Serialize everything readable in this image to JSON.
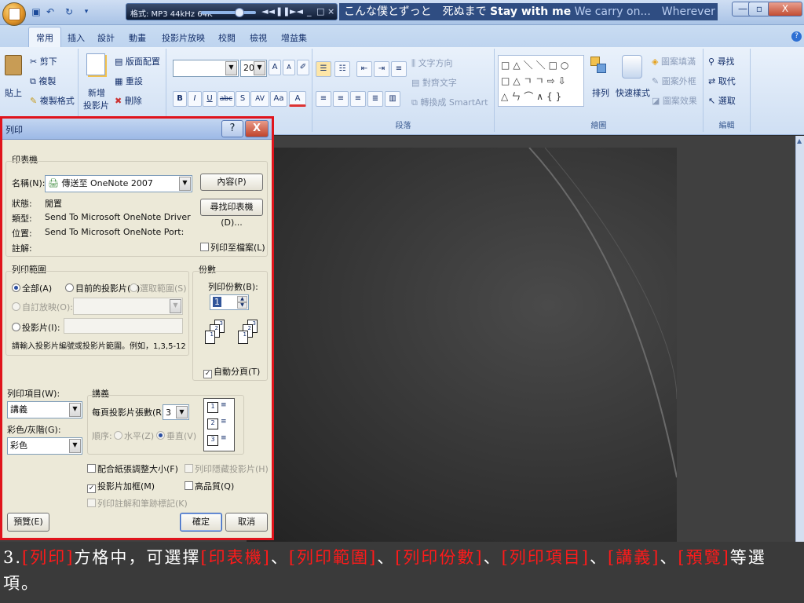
{
  "title_bar": {
    "player_format": "格式: MP3 44kHz 64K",
    "player_controls": [
      "◄◄",
      "❚❚",
      "►◄",
      "_",
      "□",
      "×"
    ],
    "song_text_jp": "こんな僕とずっと　死ぬまで",
    "song_text_en": "Stay with me",
    "song_text_tail": "We carry on...　Wherever",
    "window_controls": [
      "—",
      "▫",
      "X"
    ]
  },
  "tabs": [
    "常用",
    "插入",
    "設計",
    "動畫",
    "投影片放映",
    "校閱",
    "檢視",
    "增益集"
  ],
  "ribbon": {
    "clipboard": {
      "paste": "貼上",
      "cut": "剪下",
      "copy": "複製",
      "format_painter": "複製格式"
    },
    "slides": {
      "new_slide_1": "新增",
      "new_slide_2": "投影片",
      "layout": "版面配置",
      "reset": "重設",
      "delete": "刪除"
    },
    "font": {
      "font_name": "",
      "font_size": "20",
      "bold": "B",
      "italic": "I",
      "underline": "U",
      "strike": "abc",
      "shadow": "S",
      "spacing": "AV",
      "case": "Aa",
      "color": "A",
      "grow": "A",
      "shrink": "A"
    },
    "paragraph": {
      "text_direction": "文字方向",
      "align_text": "對齊文字",
      "smartart": "轉換成 SmartArt",
      "label": "段落"
    },
    "drawing": {
      "shapes": "□△＼＼□○\n□△ㄱㄱ⇨⇩\n△ㄣ⌒∧{}",
      "arrange": "排列",
      "quick_styles": "快速樣式",
      "fill": "圖案填滿",
      "outline": "圖案外框",
      "effects": "圖案效果",
      "label": "繪圖"
    },
    "editing": {
      "find": "尋找",
      "replace": "取代",
      "select": "選取",
      "label": "編輯"
    }
  },
  "dialog": {
    "title": "列印",
    "help": "?",
    "close": "X",
    "printer_group": "印表機",
    "name_label": "名稱(N):",
    "name_value": "傳送至 OneNote 2007",
    "properties_btn": "內容(P)",
    "find_printer_btn": "尋找印表機(D)...",
    "status_label": "狀態:",
    "status_value": "閒置",
    "type_label": "類型:",
    "type_value": "Send To Microsoft OneNote Driver",
    "location_label": "位置:",
    "location_value": "Send To Microsoft OneNote Port:",
    "comment_label": "註解:",
    "print_to_file": "列印至檔案(L)",
    "range_group": "列印範圍",
    "range_all": "全部(A)",
    "range_current": "目前的投影片(C)",
    "range_selection": "選取範圍(S)",
    "range_custom": "自訂放映(O):",
    "range_slides": "投影片(I):",
    "range_hint": "請輸入投影片編號或投影片範圍。例如，1,3,5-12",
    "copies_group": "份數",
    "copies_label": "列印份數(B):",
    "copies_value": "1",
    "collate": "自動分頁(T)",
    "print_what_label": "列印項目(W):",
    "print_what_value": "講義",
    "color_label": "彩色/灰階(G):",
    "color_value": "彩色",
    "handouts_group": "講義",
    "per_page_label": "每頁投影片張數(R):",
    "per_page_value": "3",
    "order_label": "順序:",
    "order_horizontal": "水平(Z)",
    "order_vertical": "垂直(V)",
    "scale_to_fit": "配合紙張調整大小(F)",
    "frame_slides": "投影片加框(M)",
    "print_comments": "列印註解和筆跡標記(K)",
    "print_hidden": "列印隱藏投影片(H)",
    "high_quality": "高品質(Q)",
    "preview_btn": "預覽(E)",
    "ok_btn": "確定",
    "cancel_btn": "取消"
  },
  "caption": {
    "prefix": "3.",
    "t1": "[列印]",
    "t2": "方格中，可選擇",
    "t3": "[印表機]",
    "t4": "、",
    "t5": "[列印範圍]",
    "t6": "、",
    "t7": "[列印份數]",
    "t8": "、",
    "t9": "[列印項目]",
    "t10": "、",
    "t11": "[講義]",
    "t12": "、",
    "t13": "[預覽]",
    "t14": "等選項。"
  },
  "colors": {
    "highlight": "#ff1a1a",
    "dialog_border": "#e0141c"
  }
}
